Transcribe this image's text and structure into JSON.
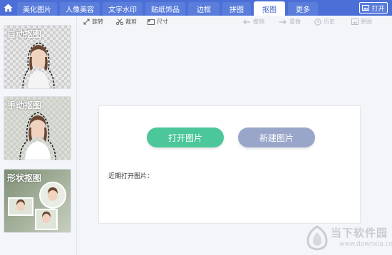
{
  "tabs": [
    {
      "label": "美化图片"
    },
    {
      "label": "人像美容"
    },
    {
      "label": "文字水印"
    },
    {
      "label": "贴纸饰品"
    },
    {
      "label": "边框"
    },
    {
      "label": "拼图"
    },
    {
      "label": "抠图",
      "active": true
    },
    {
      "label": "更多"
    }
  ],
  "open_button": {
    "label": "打开",
    "icon": "image-icon"
  },
  "left_cards": [
    {
      "label": "自动抠图"
    },
    {
      "label": "手动抠图"
    },
    {
      "label": "形状抠图"
    }
  ],
  "toolbar": {
    "rotate": "旋转",
    "crop": "裁剪",
    "size": "尺寸",
    "undo": "撤销",
    "redo": "重做",
    "history": "历史",
    "original": "原图"
  },
  "dialog": {
    "open_label": "打开图片",
    "new_label": "新建图片",
    "recent_label": "近期打开图片："
  },
  "watermark": {
    "text": "当下软件园",
    "url": "www.downxia.com"
  },
  "colors": {
    "topbar": "#4b6fd6",
    "open_btn": "#4bc79a",
    "new_btn": "#9aa6c9"
  }
}
